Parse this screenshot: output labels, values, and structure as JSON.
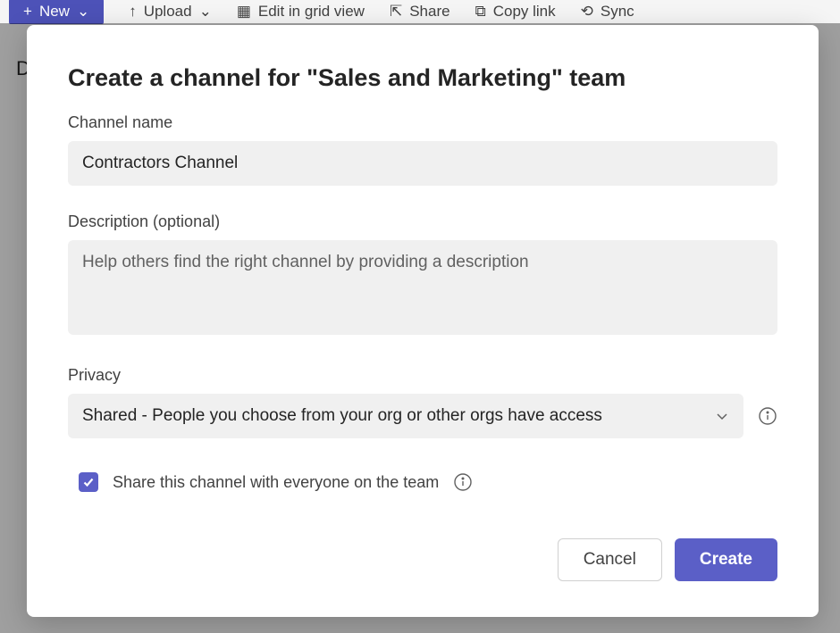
{
  "toolbar": {
    "new_label": "New",
    "upload_label": "Upload",
    "edit_label": "Edit in grid view",
    "share_label": "Share",
    "copylink_label": "Copy link",
    "sync_label": "Sync"
  },
  "bg_letter": "D",
  "dialog": {
    "title": "Create a channel for \"Sales and Marketing\" team",
    "channel_name_label": "Channel name",
    "channel_name_value": "Contractors Channel",
    "description_label": "Description (optional)",
    "description_placeholder": "Help others find the right channel by providing a description",
    "privacy_label": "Privacy",
    "privacy_value": "Shared - People you choose from your org or other orgs have access",
    "share_checkbox_label": "Share this channel with everyone on the team",
    "share_checkbox_checked": true,
    "cancel_label": "Cancel",
    "create_label": "Create"
  }
}
